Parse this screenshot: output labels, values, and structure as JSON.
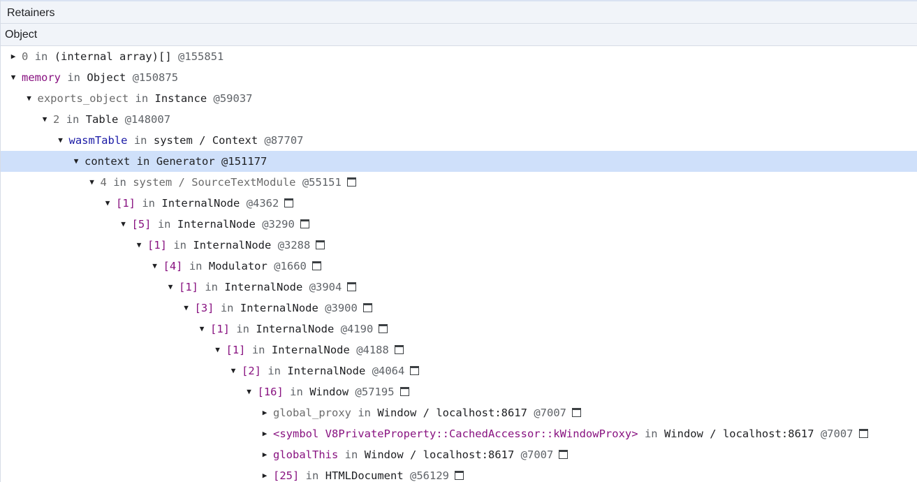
{
  "panel": {
    "title": "Retainers",
    "column_header": "Object"
  },
  "rows": [
    {
      "depth": 0,
      "expanded": false,
      "name": "0",
      "name_style": "gray",
      "kw": "in",
      "cls": "(internal array)[]",
      "id": "@155851",
      "reveal": false
    },
    {
      "depth": 0,
      "expanded": true,
      "name": "memory",
      "name_style": "prop",
      "kw": "in",
      "cls": "Object",
      "id": "@150875",
      "reveal": false
    },
    {
      "depth": 1,
      "expanded": true,
      "name": "exports_object",
      "name_style": "gray",
      "kw": "in",
      "cls": "Instance",
      "id": "@59037",
      "reveal": false
    },
    {
      "depth": 2,
      "expanded": true,
      "name": "2",
      "name_style": "gray",
      "kw": "in",
      "cls": "Table",
      "id": "@148007",
      "reveal": false
    },
    {
      "depth": 3,
      "expanded": true,
      "name": "wasmTable",
      "name_style": "ctx",
      "kw": "in",
      "cls": "system / Context",
      "id": "@87707",
      "reveal": false
    },
    {
      "depth": 4,
      "expanded": true,
      "name": "context",
      "name_style": "selected",
      "kw": "in",
      "cls": "Generator",
      "id": "@151177",
      "reveal": false,
      "selected": true
    },
    {
      "depth": 5,
      "expanded": true,
      "name": "4",
      "name_style": "gray",
      "kw": "in",
      "cls": "system / SourceTextModule",
      "cls_style": "gray",
      "id": "@55151",
      "reveal": true
    },
    {
      "depth": 6,
      "expanded": true,
      "name": "[1]",
      "name_style": "index",
      "kw": "in",
      "cls": "InternalNode",
      "id": "@4362",
      "reveal": true
    },
    {
      "depth": 7,
      "expanded": true,
      "name": "[5]",
      "name_style": "index",
      "kw": "in",
      "cls": "InternalNode",
      "id": "@3290",
      "reveal": true
    },
    {
      "depth": 8,
      "expanded": true,
      "name": "[1]",
      "name_style": "index",
      "kw": "in",
      "cls": "InternalNode",
      "id": "@3288",
      "reveal": true
    },
    {
      "depth": 9,
      "expanded": true,
      "name": "[4]",
      "name_style": "index",
      "kw": "in",
      "cls": "Modulator",
      "id": "@1660",
      "reveal": true
    },
    {
      "depth": 10,
      "expanded": true,
      "name": "[1]",
      "name_style": "index",
      "kw": "in",
      "cls": "InternalNode",
      "id": "@3904",
      "reveal": true
    },
    {
      "depth": 11,
      "expanded": true,
      "name": "[3]",
      "name_style": "index",
      "kw": "in",
      "cls": "InternalNode",
      "id": "@3900",
      "reveal": true
    },
    {
      "depth": 12,
      "expanded": true,
      "name": "[1]",
      "name_style": "index",
      "kw": "in",
      "cls": "InternalNode",
      "id": "@4190",
      "reveal": true
    },
    {
      "depth": 13,
      "expanded": true,
      "name": "[1]",
      "name_style": "index",
      "kw": "in",
      "cls": "InternalNode",
      "id": "@4188",
      "reveal": true
    },
    {
      "depth": 14,
      "expanded": true,
      "name": "[2]",
      "name_style": "index",
      "kw": "in",
      "cls": "InternalNode",
      "id": "@4064",
      "reveal": true
    },
    {
      "depth": 15,
      "expanded": true,
      "name": "[16]",
      "name_style": "index",
      "kw": "in",
      "cls": "Window",
      "id": "@57195",
      "reveal": true
    },
    {
      "depth": 16,
      "expanded": false,
      "name": "global_proxy",
      "name_style": "gray",
      "kw": "in",
      "cls": "Window / localhost:8617",
      "id": "@7007",
      "reveal": true
    },
    {
      "depth": 16,
      "expanded": false,
      "name": "<symbol V8PrivateProperty::CachedAccessor::kWindowProxy>",
      "name_style": "prop",
      "kw": "in",
      "cls": "Window / localhost:8617",
      "id": "@7007",
      "reveal": true
    },
    {
      "depth": 16,
      "expanded": false,
      "name": "globalThis",
      "name_style": "prop",
      "kw": "in",
      "cls": "Window / localhost:8617",
      "id": "@7007",
      "reveal": true
    },
    {
      "depth": 16,
      "expanded": false,
      "name": "[25]",
      "name_style": "index",
      "kw": "in",
      "cls": "HTMLDocument",
      "id": "@56129",
      "reveal": true
    }
  ]
}
